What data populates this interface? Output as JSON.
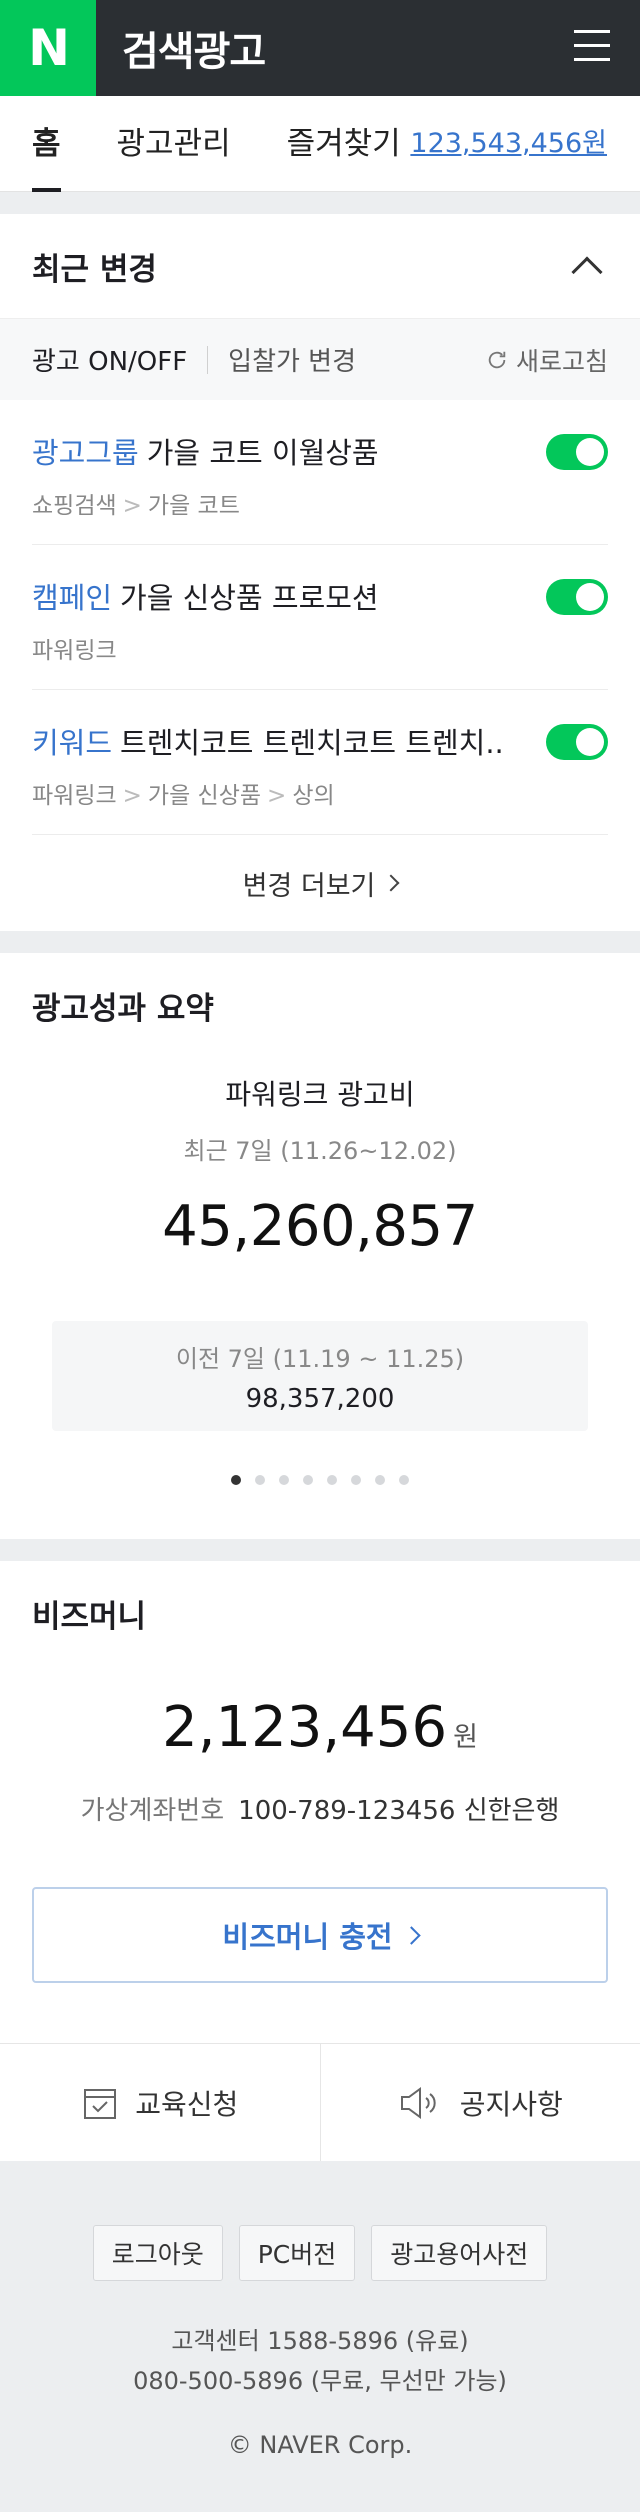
{
  "header": {
    "logo": "N",
    "title": "검색광고",
    "menu_icon": "hamburger-icon"
  },
  "tabs": [
    {
      "label": "홈",
      "active": true
    },
    {
      "label": "광고관리",
      "active": false
    },
    {
      "label": "즐겨찾기",
      "active": false
    }
  ],
  "balance_link": "123,543,456원",
  "recent": {
    "title": "최근 변경",
    "filter_onoff": "광고 ON/OFF",
    "filter_bid": "입찰가 변경",
    "refresh_label": "새로고침",
    "items": [
      {
        "type": "광고그룹",
        "name": "가을 코트 이월상품",
        "path": [
          "쇼핑검색",
          "가을 코트"
        ],
        "toggle": "on"
      },
      {
        "type": "캠페인",
        "name": "가을 신상품 프로모션",
        "path": [
          "파워링크"
        ],
        "toggle": "on"
      },
      {
        "type": "키워드",
        "name": "트렌치코트 트렌치코트 트렌치..",
        "path": [
          "파워링크",
          "가을 신상품",
          "상의"
        ],
        "toggle": "on"
      }
    ],
    "more_label": "변경 더보기"
  },
  "performance": {
    "title": "광고성과 요약",
    "subtitle": "파워링크 광고비",
    "period": "최근 7일 (11.26~12.02)",
    "amount": "45,260,857",
    "prev_label": "이전 7일 (11.19 ~ 11.25)",
    "prev_value": "98,357,200",
    "pager": {
      "count": 8,
      "active": 1
    }
  },
  "bizmoney": {
    "title": "비즈머니",
    "amount": "2,123,456",
    "unit": "원",
    "account_label": "가상계좌번호",
    "account_value": "100-789-123456 신한은행",
    "charge_label": "비즈머니 충전"
  },
  "quick_links": {
    "education": "교육신청",
    "notice": "공지사항"
  },
  "footer": {
    "logout": "로그아웃",
    "pc_version": "PC버전",
    "glossary": "광고용어사전",
    "cs_line1": "고객센터 1588-5896 (유료)",
    "cs_line2": "080-500-5896 (무료, 무선만 가능)",
    "copyright": "© NAVER Corp."
  },
  "colors": {
    "brand_green": "#03c75a",
    "header_dark": "#2b2f33",
    "link_blue": "#3774cc"
  }
}
